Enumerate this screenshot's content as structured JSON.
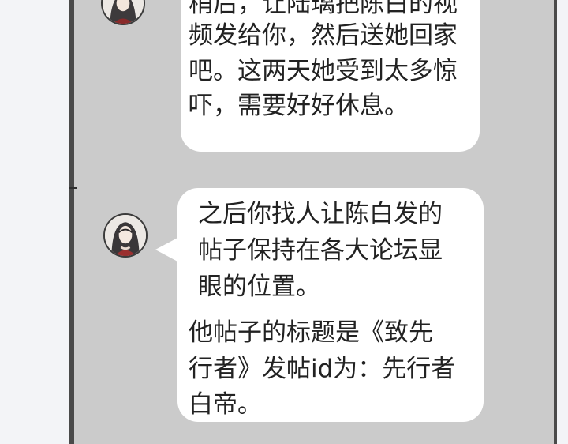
{
  "chat": {
    "messages": [
      {
        "lines": [
          "稍后，让陆璃把陈白的视",
          "频发给你，然后送她回家",
          "吧。这两天她受到太多惊",
          "吓，需要好好休息。"
        ]
      },
      {
        "lines": [
          "之后你找人让陈白发的",
          "帖子保持在各大论坛显",
          "眼的位置。",
          "他帖子的标题是《致先",
          "行者》发帖id为：先行者",
          "白帝。"
        ]
      }
    ]
  }
}
